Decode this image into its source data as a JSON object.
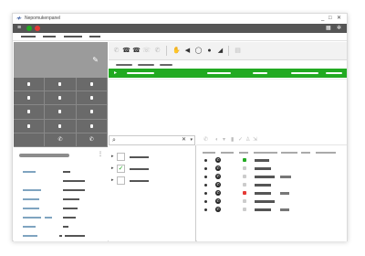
{
  "app": {
    "logo_glyph": "≁",
    "title": "Nepomukenpanel",
    "controls": {
      "minimize": "_",
      "maximize": "□",
      "close": "✕"
    }
  },
  "toolbar": {
    "icons": [
      {
        "name": "menu-icon",
        "glyph": "≡",
        "color": "#ffffff"
      },
      {
        "name": "status-available-icon",
        "glyph": "●",
        "color": "#22aa22"
      },
      {
        "name": "status-dnd-icon",
        "glyph": "●",
        "color": "#e53935"
      }
    ],
    "right_icons": [
      {
        "name": "layout-icon",
        "glyph": "▦"
      },
      {
        "name": "settings-icon",
        "glyph": "✲"
      }
    ]
  },
  "phonebar": {
    "icons": [
      {
        "name": "dial-icon",
        "glyph": "✆",
        "color": "#bbbbbb"
      },
      {
        "name": "hangup-icon",
        "glyph": "☎",
        "color": "#333333"
      },
      {
        "name": "transfer-icon",
        "glyph": "☎",
        "color": "#333333"
      },
      {
        "name": "conference-icon",
        "glyph": "☏",
        "color": "#bbbbbb"
      },
      {
        "name": "forward-icon",
        "glyph": "✆",
        "color": "#bbbbbb"
      },
      {
        "name": "hand-icon",
        "glyph": "✋",
        "color": "#f0a030"
      },
      {
        "name": "speaker-icon",
        "glyph": "◀",
        "color": "#333333"
      },
      {
        "name": "headset-icon",
        "glyph": "◯",
        "color": "#333333"
      },
      {
        "name": "mute-icon",
        "glyph": "●",
        "color": "#333333"
      },
      {
        "name": "record-icon",
        "glyph": "◢",
        "color": "#333333"
      },
      {
        "name": "clipboard-icon",
        "glyph": "▤",
        "color": "#bbbbbb"
      }
    ]
  },
  "display": {
    "icon_glyph": "✎"
  },
  "keypad": {
    "keys": [
      "dot",
      "dot",
      "dot",
      "dot",
      "dot",
      "dot",
      "dot",
      "dot",
      "dot",
      "dot",
      "dot",
      "dot",
      "empty",
      "call",
      "hangup"
    ],
    "call_glyph": "✆",
    "hangup_glyph": "✆"
  },
  "contact": {
    "more_glyph": "⋮"
  },
  "callrow": {
    "icon_glyph": "▸"
  },
  "search": {
    "placeholder": "",
    "search_glyph": "⌕",
    "clear_glyph": "✕",
    "dropdown_glyph": "▾"
  },
  "journalbar": {
    "icons": [
      {
        "name": "journal-call-icon",
        "glyph": "✆"
      },
      {
        "name": "journal-filter-icon",
        "glyph": "◐"
      },
      {
        "name": "journal-dropdown-icon",
        "glyph": "▾"
      },
      {
        "name": "journal-delete-icon",
        "glyph": "▮"
      },
      {
        "name": "journal-edit-icon",
        "glyph": "✓"
      },
      {
        "name": "journal-user-icon",
        "glyph": "♙"
      },
      {
        "name": "journal-export-icon",
        "glyph": "⇲"
      }
    ]
  },
  "favorites": {
    "arrow_glyph": "▸",
    "items": [
      {
        "checked": false,
        "check_glyph": ""
      },
      {
        "checked": true,
        "check_glyph": "✓"
      },
      {
        "checked": false,
        "check_glyph": ""
      }
    ]
  },
  "journal": {
    "phone_glyph": "✆",
    "rows": [
      {
        "status_color": "#22aa22"
      },
      {
        "status_color": "#cccccc"
      },
      {
        "status_color": "#cccccc"
      },
      {
        "status_color": "#cccccc"
      },
      {
        "status_color": "#e53935"
      },
      {
        "status_color": "#cccccc"
      },
      {
        "status_color": "#cccccc"
      }
    ]
  },
  "colors": {
    "accent_green": "#22aa22",
    "alert_red": "#e53935",
    "dark_toolbar": "#555555",
    "keypad_gray": "#6a6a6a",
    "display_gray": "#9b9b9b"
  }
}
